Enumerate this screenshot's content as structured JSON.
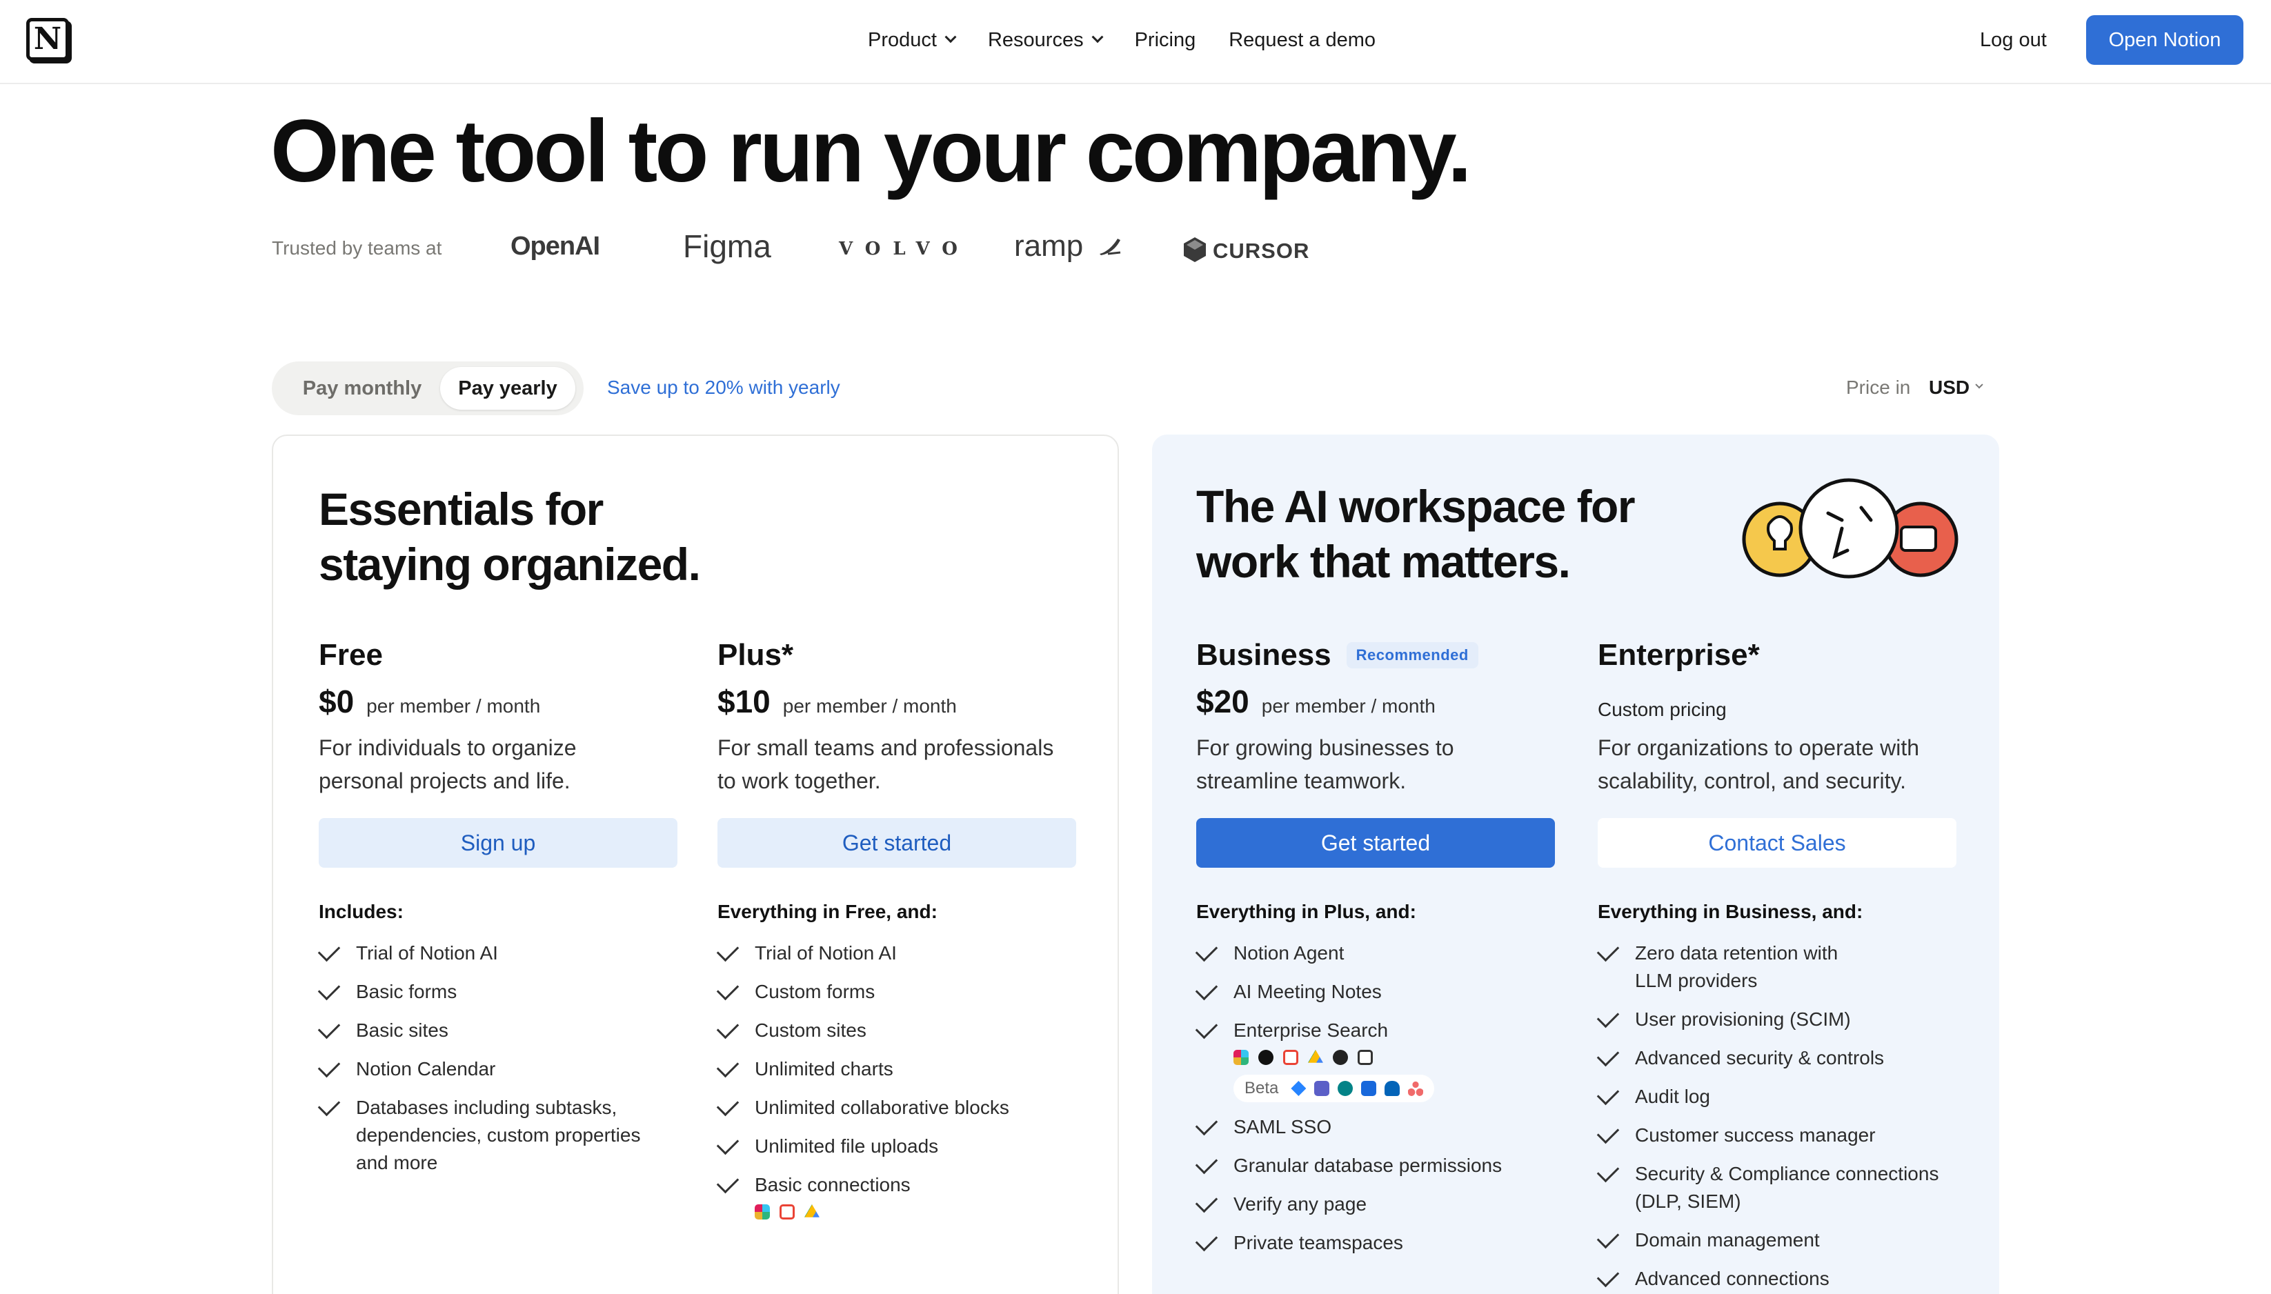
{
  "nav": {
    "logo": "N",
    "links": [
      {
        "label": "Product",
        "has_dropdown": true
      },
      {
        "label": "Resources",
        "has_dropdown": true
      },
      {
        "label": "Pricing",
        "has_dropdown": false
      },
      {
        "label": "Request a demo",
        "has_dropdown": false
      }
    ],
    "logout": "Log out",
    "open_button": "Open Notion"
  },
  "hero": {
    "title": "One tool to run your company.",
    "trusted_label": "Trusted by teams at",
    "brands": [
      "OpenAI",
      "Figma",
      "VOLVO",
      "ramp",
      "CURSOR"
    ]
  },
  "billing": {
    "monthly": "Pay monthly",
    "yearly": "Pay yearly",
    "selected": "yearly",
    "save_note": "Save up to 20% with yearly",
    "price_in_label": "Price in",
    "currency": "USD"
  },
  "left_card": {
    "heading_line1": "Essentials for",
    "heading_line2": "staying organized.",
    "plans": [
      {
        "name": "Free",
        "price": "$0",
        "per": "per member / month",
        "desc_line1": "For individuals to organize",
        "desc_line2": "personal projects and life.",
        "cta": "Sign up",
        "includes": "Includes:",
        "features": [
          [
            "Trial of Notion AI"
          ],
          [
            "Basic forms"
          ],
          [
            "Basic sites"
          ],
          [
            "Notion Calendar"
          ],
          [
            "Databases including subtasks,",
            "dependencies, custom properties",
            "and more"
          ]
        ]
      },
      {
        "name": "Plus*",
        "price": "$10",
        "per": "per member / month",
        "desc_line1": "For small teams and professionals",
        "desc_line2": "to work together.",
        "cta": "Get started",
        "includes": "Everything in Free, and:",
        "features": [
          [
            "Trial of Notion AI"
          ],
          [
            "Custom forms"
          ],
          [
            "Custom sites"
          ],
          [
            "Unlimited charts"
          ],
          [
            "Unlimited collaborative blocks"
          ],
          [
            "Unlimited file uploads"
          ],
          [
            "Basic connections"
          ]
        ],
        "connection_icons": [
          "slack-icon",
          "gmail-icon",
          "google-drive-icon"
        ]
      }
    ]
  },
  "right_card": {
    "heading_line1": "The AI workspace for",
    "heading_line2": "work that matters.",
    "plans": [
      {
        "name": "Business",
        "badge": "Recommended",
        "price": "$20",
        "per": "per member / month",
        "desc_line1": "For growing businesses to",
        "desc_line2": "streamline teamwork.",
        "cta": "Get started",
        "includes": "Everything in Plus, and:",
        "features": [
          [
            "Notion Agent"
          ],
          [
            "AI Meeting Notes"
          ],
          [
            "Enterprise Search"
          ]
        ],
        "search_icons": [
          "slack-icon",
          "github-icon",
          "gmail-icon",
          "google-drive-icon",
          "linear-icon",
          "google-docs-icon"
        ],
        "beta_label": "Beta",
        "beta_icons": [
          "jira-icon",
          "teams-icon",
          "sharepoint-icon",
          "confluence-icon",
          "onedrive-icon",
          "asana-icon"
        ],
        "features_after": [
          [
            "SAML SSO"
          ],
          [
            "Granular database permissions"
          ],
          [
            "Verify any page"
          ],
          [
            "Private teamspaces"
          ]
        ]
      },
      {
        "name": "Enterprise*",
        "custom_pricing": "Custom pricing",
        "desc_line1": "For organizations to operate with",
        "desc_line2": "scalability, control, and security.",
        "cta": "Contact Sales",
        "includes": "Everything in Business, and:",
        "features": [
          [
            "Zero data retention with",
            "LLM providers"
          ],
          [
            "User provisioning (SCIM)"
          ],
          [
            "Advanced security & controls"
          ],
          [
            "Audit log"
          ],
          [
            "Customer success manager"
          ],
          [
            "Security & Compliance connections",
            "(DLP, SIEM)"
          ],
          [
            "Domain management"
          ],
          [
            "Advanced connections"
          ]
        ]
      }
    ]
  },
  "colors": {
    "accent": "#2f6fd6",
    "light_button": "#e4eefb",
    "right_card_bg": "#f0f5fc"
  }
}
